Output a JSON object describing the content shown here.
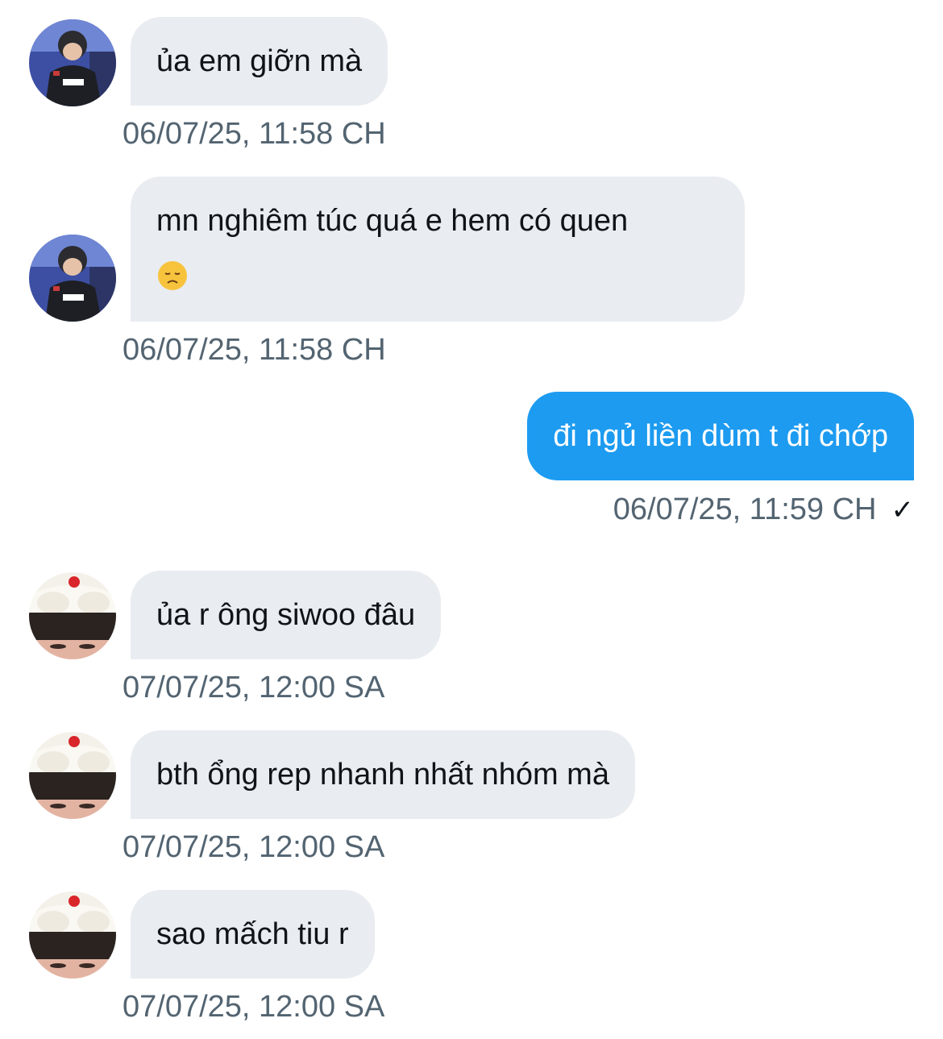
{
  "messages": [
    {
      "direction": "incoming",
      "sender_avatar": "avatar-player-jersey",
      "text_lines": [
        "ủa em giỡn mà"
      ],
      "timestamp": "06/07/25, 11:58 CH"
    },
    {
      "direction": "incoming",
      "sender_avatar": "avatar-player-jersey",
      "text_lines": [
        "mn nghiêm túc quá e hem có quen"
      ],
      "emoji": "disappointed-face-emoji",
      "timestamp": "06/07/25, 11:58 CH"
    },
    {
      "direction": "outgoing",
      "text_lines": [
        "đi ngủ liền dùm t đi chớp"
      ],
      "timestamp": "06/07/25, 11:59 CH",
      "status": "✓"
    },
    {
      "direction": "incoming",
      "sender_avatar": "avatar-whipped-cream-hair",
      "text_lines": [
        "ủa r ông siwoo đâu"
      ],
      "timestamp": "07/07/25, 12:00 SA"
    },
    {
      "direction": "incoming",
      "sender_avatar": "avatar-whipped-cream-hair",
      "text_lines": [
        "bth ổng rep nhanh nhất nhóm mà"
      ],
      "timestamp": "07/07/25, 12:00 SA"
    },
    {
      "direction": "incoming",
      "sender_avatar": "avatar-whipped-cream-hair",
      "text_lines": [
        "sao mấch tiu r"
      ],
      "timestamp": "07/07/25, 12:00 SA"
    }
  ],
  "colors": {
    "incoming_bubble": "#e9ecf0",
    "outgoing_bubble": "#1d9bf0",
    "timestamp_text": "#536471",
    "message_text": "#0f1419"
  }
}
